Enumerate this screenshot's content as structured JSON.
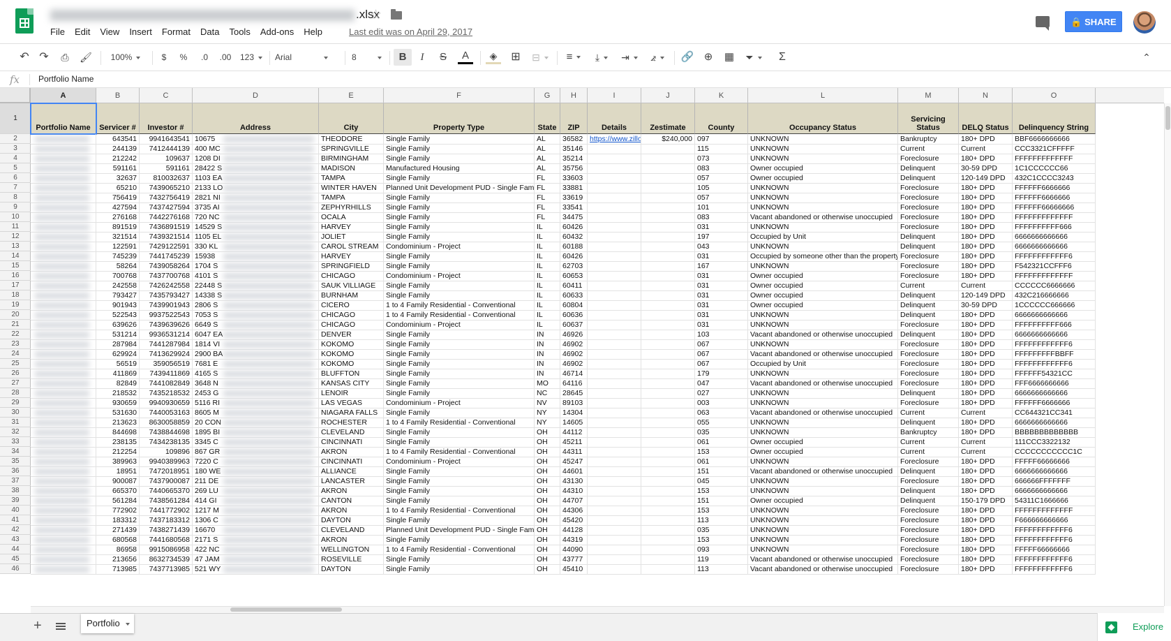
{
  "doc": {
    "title_suffix": ".xlsx",
    "menu": [
      "File",
      "Edit",
      "View",
      "Insert",
      "Format",
      "Data",
      "Tools",
      "Add-ons",
      "Help"
    ],
    "last_edit": "Last edit was on April 29, 2017",
    "share_label": "SHARE"
  },
  "toolbar": {
    "zoom": "100%",
    "currency": "$",
    "percent": "%",
    "dec_less": ".0",
    "dec_more": ".00",
    "more_formats": "123",
    "font": "Arial",
    "font_size": "8",
    "bold": "B",
    "italic": "I",
    "strike": "S",
    "text_color": "A"
  },
  "formula_bar": {
    "fx": "fx",
    "value": "Portfolio Name"
  },
  "columns": [
    "A",
    "B",
    "C",
    "D",
    "E",
    "F",
    "G",
    "H",
    "I",
    "J",
    "K",
    "L",
    "M",
    "N",
    "O"
  ],
  "headers": [
    "Portfolio Name",
    "Servicer #",
    "Investor #",
    "Address",
    "City",
    "Property Type",
    "State",
    "ZIP",
    "Details",
    "Zestimate",
    "County",
    "Occupancy Status",
    "Servicing Status",
    "DELQ Status",
    "Delinquency String"
  ],
  "rows": [
    [
      "643541",
      "9941643541",
      "10675",
      "THEODORE",
      "Single Family",
      "AL",
      "36582",
      "https://www.zillow",
      "$240,000",
      "097",
      "UNKNOWN",
      "Bankruptcy",
      "180+ DPD",
      "BBF6666666666"
    ],
    [
      "244139",
      "7412444139",
      "400 MC",
      "SPRINGVILLE",
      "Single Family",
      "AL",
      "35146",
      "",
      "",
      "115",
      "UNKNOWN",
      "Current",
      "Current",
      "CCC3321CFFFFF"
    ],
    [
      "212242",
      "109637",
      "1208 DI",
      "BIRMINGHAM",
      "Single Family",
      "AL",
      "35214",
      "",
      "",
      "073",
      "UNKNOWN",
      "Foreclosure",
      "180+ DPD",
      "FFFFFFFFFFFFF"
    ],
    [
      "591161",
      "591161",
      "28422 S",
      "MADISON",
      "Manufactured Housing",
      "AL",
      "35756",
      "",
      "",
      "083",
      "Owner occupied",
      "Delinquent",
      "30-59 DPD",
      "1C1CCCCCC66"
    ],
    [
      "32637",
      "810032637",
      "1103 EA",
      "TAMPA",
      "Single Family",
      "FL",
      "33603",
      "",
      "",
      "057",
      "Owner occupied",
      "Delinquent",
      "120-149 DPD",
      "432C1CCCC3243"
    ],
    [
      "65210",
      "7439065210",
      "2133 LO",
      "WINTER HAVEN",
      "Planned Unit Development PUD - Single Family",
      "FL",
      "33881",
      "",
      "",
      "105",
      "UNKNOWN",
      "Foreclosure",
      "180+ DPD",
      "FFFFFF6666666"
    ],
    [
      "756419",
      "7432756419",
      "2821 NI",
      "TAMPA",
      "Single Family",
      "FL",
      "33619",
      "",
      "",
      "057",
      "UNKNOWN",
      "Foreclosure",
      "180+ DPD",
      "FFFFFF6666666"
    ],
    [
      "427594",
      "7437427594",
      "3735 AI",
      "ZEPHYRHILLS",
      "Single Family",
      "FL",
      "33541",
      "",
      "",
      "101",
      "UNKNOWN",
      "Foreclosure",
      "180+ DPD",
      "FFFFFF66666666"
    ],
    [
      "276168",
      "7442276168",
      "720 NC",
      "OCALA",
      "Single Family",
      "FL",
      "34475",
      "",
      "",
      "083",
      "Vacant abandoned or otherwise unoccupied",
      "Foreclosure",
      "180+ DPD",
      "FFFFFFFFFFFFF"
    ],
    [
      "891519",
      "7436891519",
      "14529 S",
      "HARVEY",
      "Single Family",
      "IL",
      "60426",
      "",
      "",
      "031",
      "UNKNOWN",
      "Foreclosure",
      "180+ DPD",
      "FFFFFFFFFF666"
    ],
    [
      "321514",
      "7439321514",
      "1105 EL",
      "JOLIET",
      "Single Family",
      "IL",
      "60432",
      "",
      "",
      "197",
      "Occupied by Unit",
      "Delinquent",
      "180+ DPD",
      "6666666666666"
    ],
    [
      "122591",
      "7429122591",
      "330 KL",
      "CAROL STREAM",
      "Condominium - Project",
      "IL",
      "60188",
      "",
      "",
      "043",
      "UNKNOWN",
      "Delinquent",
      "180+ DPD",
      "6666666666666"
    ],
    [
      "745239",
      "7441745239",
      "15938",
      "HARVEY",
      "Single Family",
      "IL",
      "60426",
      "",
      "",
      "031",
      "Occupied by someone other than the property ow",
      "Foreclosure",
      "180+ DPD",
      "FFFFFFFFFFFF6"
    ],
    [
      "58264",
      "7439058264",
      "1704 S",
      "SPRINGFIELD",
      "Single Family",
      "IL",
      "62703",
      "",
      "",
      "167",
      "UNKNOWN",
      "Foreclosure",
      "180+ DPD",
      "F542321CCFFF6"
    ],
    [
      "700768",
      "7437700768",
      "4101 S",
      "CHICAGO",
      "Condominium - Project",
      "IL",
      "60653",
      "",
      "",
      "031",
      "Owner occupied",
      "Foreclosure",
      "180+ DPD",
      "FFFFFFFFFFFFF"
    ],
    [
      "242558",
      "7426242558",
      "22448 S",
      "SAUK VILLIAGE",
      "Single Family",
      "IL",
      "60411",
      "",
      "",
      "031",
      "Owner occupied",
      "Current",
      "Current",
      "CCCCCC6666666"
    ],
    [
      "793427",
      "7435793427",
      "14338 S",
      "BURNHAM",
      "Single Family",
      "IL",
      "60633",
      "",
      "",
      "031",
      "Owner occupied",
      "Delinquent",
      "120-149 DPD",
      "432C216666666"
    ],
    [
      "901943",
      "7439901943",
      "2806 S",
      "CICERO",
      "1 to 4 Family Residential - Conventional",
      "IL",
      "60804",
      "",
      "",
      "031",
      "Owner occupied",
      "Delinquent",
      "30-59 DPD",
      "1CCCCCC666666"
    ],
    [
      "522543",
      "9937522543",
      "7053 S",
      "CHICAGO",
      "1 to 4 Family Residential - Conventional",
      "IL",
      "60636",
      "",
      "",
      "031",
      "UNKNOWN",
      "Delinquent",
      "180+ DPD",
      "6666666666666"
    ],
    [
      "639626",
      "7439639626",
      "6649 S",
      "CHICAGO",
      "Condominium - Project",
      "IL",
      "60637",
      "",
      "",
      "031",
      "UNKNOWN",
      "Foreclosure",
      "180+ DPD",
      "FFFFFFFFFF666"
    ],
    [
      "531214",
      "9936531214",
      "6047 EA",
      "DENVER",
      "Single Family",
      "IN",
      "46926",
      "",
      "",
      "103",
      "Vacant abandoned or otherwise unoccupied",
      "Delinquent",
      "180+ DPD",
      "6666666666666"
    ],
    [
      "287984",
      "7441287984",
      "1814 VI",
      "KOKOMO",
      "Single Family",
      "IN",
      "46902",
      "",
      "",
      "067",
      "UNKNOWN",
      "Foreclosure",
      "180+ DPD",
      "FFFFFFFFFFFF6"
    ],
    [
      "629924",
      "7413629924",
      "2900 BA",
      "KOKOMO",
      "Single Family",
      "IN",
      "46902",
      "",
      "",
      "067",
      "Vacant abandoned or otherwise unoccupied",
      "Foreclosure",
      "180+ DPD",
      "FFFFFFFFFBBFF"
    ],
    [
      "56519",
      "359056519",
      "7681 E",
      "KOKOMO",
      "Single Family",
      "IN",
      "46902",
      "",
      "",
      "067",
      "Occupied by Unit",
      "Foreclosure",
      "180+ DPD",
      "FFFFFFFFFFFF6"
    ],
    [
      "411869",
      "7439411869",
      "4165 S",
      "BLUFFTON",
      "Single Family",
      "IN",
      "46714",
      "",
      "",
      "179",
      "UNKNOWN",
      "Foreclosure",
      "180+ DPD",
      "FFFFFF54321CC"
    ],
    [
      "82849",
      "7441082849",
      "3648 N",
      "KANSAS CITY",
      "Single Family",
      "MO",
      "64116",
      "",
      "",
      "047",
      "Vacant abandoned or otherwise unoccupied",
      "Foreclosure",
      "180+ DPD",
      "FFF6666666666"
    ],
    [
      "218532",
      "7435218532",
      "2453 G",
      "LENOIR",
      "Single Family",
      "NC",
      "28645",
      "",
      "",
      "027",
      "UNKNOWN",
      "Delinquent",
      "180+ DPD",
      "6666666666666"
    ],
    [
      "930659",
      "9940930659",
      "5116 RI",
      "LAS VEGAS",
      "Condominium - Project",
      "NV",
      "89103",
      "",
      "",
      "003",
      "UNKNOWN",
      "Foreclosure",
      "180+ DPD",
      "FFFFFF6666666"
    ],
    [
      "531630",
      "7440053163",
      "8605 M",
      "NIAGARA FALLS",
      "Single Family",
      "NY",
      "14304",
      "",
      "",
      "063",
      "Vacant abandoned or otherwise unoccupied",
      "Current",
      "Current",
      "CC644321CC341"
    ],
    [
      "213623",
      "8630058859",
      "20 CON",
      "ROCHESTER",
      "1 to 4 Family Residential - Conventional",
      "NY",
      "14605",
      "",
      "",
      "055",
      "UNKNOWN",
      "Delinquent",
      "180+ DPD",
      "6666666666666"
    ],
    [
      "844698",
      "7438844698",
      "1895 BI",
      "CLEVELAND",
      "Single Family",
      "OH",
      "44112",
      "",
      "",
      "035",
      "UNKNOWN",
      "Bankruptcy",
      "180+ DPD",
      "BBBBBBBBBBBBB"
    ],
    [
      "238135",
      "7434238135",
      "3345 C",
      "CINCINNATI",
      "Single Family",
      "OH",
      "45211",
      "",
      "",
      "061",
      "Owner occupied",
      "Current",
      "Current",
      "111CCC3322132"
    ],
    [
      "212254",
      "109896",
      "867 GR",
      "AKRON",
      "1 to 4 Family Residential - Conventional",
      "OH",
      "44311",
      "",
      "",
      "153",
      "Owner occupied",
      "Current",
      "Current",
      "CCCCCCCCCCC1C"
    ],
    [
      "389963",
      "9940389963",
      "7220 C",
      "CINCINNATI",
      "Condominium - Project",
      "OH",
      "45247",
      "",
      "",
      "061",
      "UNKNOWN",
      "Foreclosure",
      "180+ DPD",
      "FFFFF66666666"
    ],
    [
      "18951",
      "7472018951",
      "180 WE",
      "ALLIANCE",
      "Single Family",
      "OH",
      "44601",
      "",
      "",
      "151",
      "Vacant abandoned or otherwise unoccupied",
      "Delinquent",
      "180+ DPD",
      "6666666666666"
    ],
    [
      "900087",
      "7437900087",
      "211 DE",
      "LANCASTER",
      "Single Family",
      "OH",
      "43130",
      "",
      "",
      "045",
      "UNKNOWN",
      "Foreclosure",
      "180+ DPD",
      "666666FFFFFFF"
    ],
    [
      "665370",
      "7440665370",
      "269 LU",
      "AKRON",
      "Single Family",
      "OH",
      "44310",
      "",
      "",
      "153",
      "UNKNOWN",
      "Delinquent",
      "180+ DPD",
      "6666666666666"
    ],
    [
      "561284",
      "7438561284",
      "414 GI",
      "CANTON",
      "Single Family",
      "OH",
      "44707",
      "",
      "",
      "151",
      "Owner occupied",
      "Delinquent",
      "150-179 DPD",
      "54311C1666666"
    ],
    [
      "772902",
      "7441772902",
      "1217 M",
      "AKRON",
      "1 to 4 Family Residential - Conventional",
      "OH",
      "44306",
      "",
      "",
      "153",
      "UNKNOWN",
      "Foreclosure",
      "180+ DPD",
      "FFFFFFFFFFFFF"
    ],
    [
      "183312",
      "7437183312",
      "1306 C",
      "DAYTON",
      "Single Family",
      "OH",
      "45420",
      "",
      "",
      "113",
      "UNKNOWN",
      "Foreclosure",
      "180+ DPD",
      "F666666666666"
    ],
    [
      "271439",
      "7438271439",
      "16670",
      "CLEVELAND",
      "Planned Unit Development PUD - Single Family",
      "OH",
      "44128",
      "",
      "",
      "035",
      "UNKNOWN",
      "Foreclosure",
      "180+ DPD",
      "FFFFFFFFFFFF6"
    ],
    [
      "680568",
      "7441680568",
      "2171 S",
      "AKRON",
      "Single Family",
      "OH",
      "44319",
      "",
      "",
      "153",
      "UNKNOWN",
      "Foreclosure",
      "180+ DPD",
      "FFFFFFFFFFFF6"
    ],
    [
      "86958",
      "9915086958",
      "422 NC",
      "WELLINGTON",
      "1 to 4 Family Residential - Conventional",
      "OH",
      "44090",
      "",
      "",
      "093",
      "UNKNOWN",
      "Foreclosure",
      "180+ DPD",
      "FFFFF66666666"
    ],
    [
      "213656",
      "8632734539",
      "47 JAM",
      "ROSEVILLE",
      "Single Family",
      "OH",
      "43777",
      "",
      "",
      "119",
      "Vacant abandoned or otherwise unoccupied",
      "Foreclosure",
      "180+ DPD",
      "FFFFFFFFFFFF6"
    ],
    [
      "713985",
      "7437713985",
      "521 WY",
      "DAYTON",
      "Single Family",
      "OH",
      "45410",
      "",
      "",
      "113",
      "Vacant abandoned or otherwise unoccupied",
      "Foreclosure",
      "180+ DPD",
      "FFFFFFFFFFFF6"
    ]
  ],
  "sheet_tab": "Portfolio",
  "explore_label": "Explore",
  "colors": {
    "header_fill": "#ddd9c4",
    "share_blue": "#4285f4",
    "sheets_green": "#0f9d58",
    "selection": "#4285f4"
  }
}
